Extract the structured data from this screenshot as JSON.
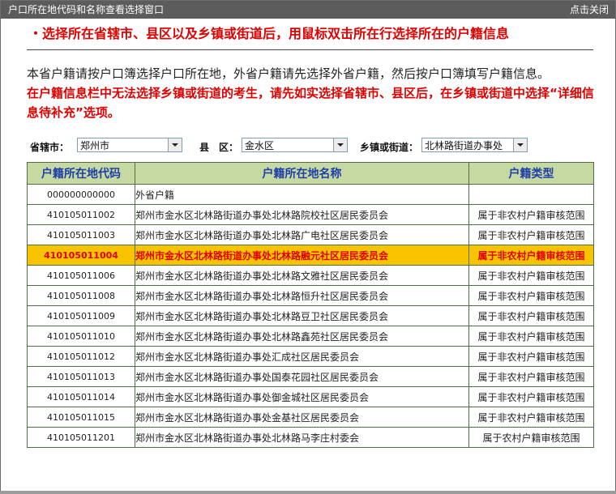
{
  "window": {
    "title": "户口所在地代码和名称查看选择窗口",
    "close_label": "点击关闭"
  },
  "headline": "・选择所在省辖市、县区以及乡镇或街道后，用鼠标双击所在行选择所在的户籍信息",
  "note": {
    "normal": "本省户籍请按户口簿选择户口所在地，外省户籍请先选择外省户籍，然后按户口簿填写户籍信息。",
    "red": "在户籍信息栏中无法选择乡镇或街道的考生，请先如实选择省辖市、县区后，在乡镇或街道中选择“详细信息待补充”选项。"
  },
  "filters": {
    "city_label": "省辖市：",
    "city_value": "郑州市",
    "county_label": "县　区：",
    "county_value": "金水区",
    "town_label": "乡镇或街道：",
    "town_value": "北林路街道办事处"
  },
  "table": {
    "headers": [
      "户籍所在地代码",
      "户籍所在地名称",
      "户籍类型"
    ],
    "rows": [
      {
        "code": "000000000000",
        "name": "外省户籍",
        "type": ""
      },
      {
        "code": "410105011002",
        "name": "郑州市金水区北林路街道办事处北林路院校社区居民委员会",
        "type": "属于非农村户籍审核范围"
      },
      {
        "code": "410105011003",
        "name": "郑州市金水区北林路街道办事处北林路广电社区居民委员会",
        "type": "属于非农村户籍审核范围"
      },
      {
        "code": "410105011004",
        "name": "郑州市金水区北林路街道办事处北林路融元社区居民委员会",
        "type": "属于非农村户籍审核范围",
        "selected": true
      },
      {
        "code": "410105011006",
        "name": "郑州市金水区北林路街道办事处北林路文雅社区居民委员会",
        "type": "属于非农村户籍审核范围"
      },
      {
        "code": "410105011008",
        "name": "郑州市金水区北林路街道办事处北林路恒升社区居民委员会",
        "type": "属于非农村户籍审核范围"
      },
      {
        "code": "410105011009",
        "name": "郑州市金水区北林路街道办事处北林路豆卫社区居民委员会",
        "type": "属于非农村户籍审核范围"
      },
      {
        "code": "410105011010",
        "name": "郑州市金水区北林路街道办事处北林路鑫苑社区居民委员会",
        "type": "属于非农村户籍审核范围"
      },
      {
        "code": "410105011012",
        "name": "郑州市金水区北林路街道办事处汇成社区居民委员会",
        "type": "属于非农村户籍审核范围"
      },
      {
        "code": "410105011013",
        "name": "郑州市金水区北林路街道办事处国泰花园社区居民委员会",
        "type": "属于非农村户籍审核范围"
      },
      {
        "code": "410105011014",
        "name": "郑州市金水区北林路街道办事处御金城社区居民委员会",
        "type": "属于非农村户籍审核范围"
      },
      {
        "code": "410105011015",
        "name": "郑州市金水区北林路街道办事处金基社区居民委员会",
        "type": "属于非农村户籍审核范围"
      },
      {
        "code": "410105011201",
        "name": "郑州市金水区北林路街道办事处北林路马李庄村委会",
        "type": "属于农村户籍审核范围"
      }
    ]
  }
}
